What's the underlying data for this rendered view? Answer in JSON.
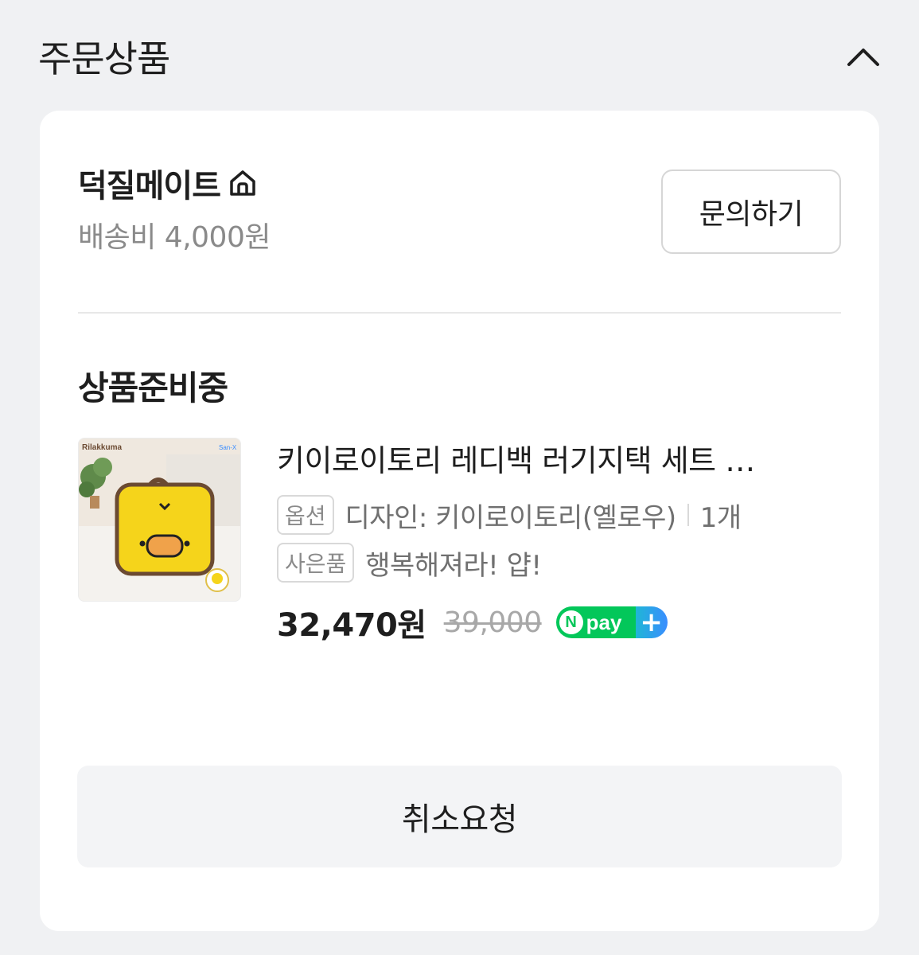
{
  "section": {
    "title": "주문상품"
  },
  "seller": {
    "name": "덕질메이트",
    "shipping": "배송비 4,000원",
    "inquiry_label": "문의하기"
  },
  "order": {
    "status": "상품준비중",
    "product": {
      "name": "키이로이토리 레디백 러기지택 세트 …",
      "thumb_brand": "Rilakkuma",
      "thumb_badge": "San-X",
      "option_tag": "옵션",
      "option_text": "디자인: 키이로이토리(옐로우)",
      "quantity": "1개",
      "gift_tag": "사은품",
      "gift_text": "행복해져라! 얍!",
      "price": "32,470원",
      "original_price": "39,000",
      "npay_label": "pay"
    },
    "cancel_label": "취소요청"
  },
  "colors": {
    "npay_green": "#03c75a",
    "npay_blue": "#3a8dff",
    "thumb_yellow": "#f5d41b"
  },
  "icons": {
    "collapse": "chevron-up-icon",
    "seller_home": "home-icon"
  }
}
